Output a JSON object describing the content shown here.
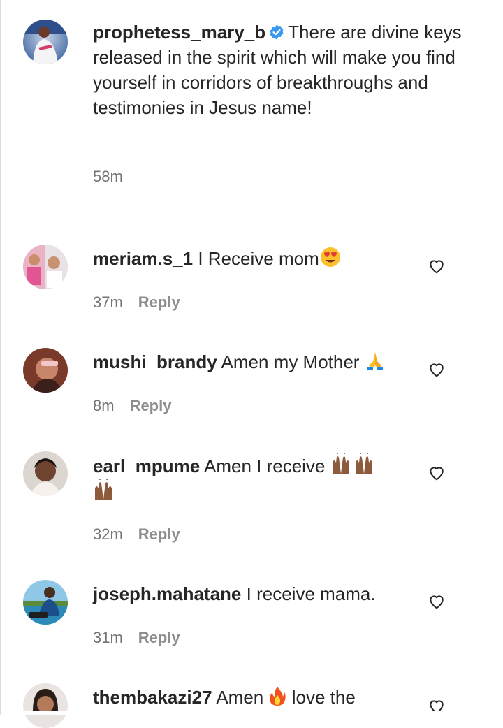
{
  "post": {
    "username": "prophetess_mary_b",
    "caption": "There are divine keys released in the spirit which will make you find yourself in corridors of breakthroughs and testimonies in Jesus name!",
    "time": "58m",
    "avatar_icon": "avatar-photo",
    "verified_icon": "verified-badge-icon",
    "verified_color": "#3897f0"
  },
  "comments": [
    {
      "username": "meriam.s_1",
      "text": "I Receive mom",
      "emoji": "heart-eyes-emoji",
      "time": "37m",
      "reply": "Reply"
    },
    {
      "username": "mushi_brandy",
      "text": "Amen my Mother",
      "emoji": "folded-hands-emoji",
      "time": "8m",
      "reply": "Reply"
    },
    {
      "username": "earl_mpume",
      "text": "Amen I receive",
      "emoji": "raising-hands-emoji",
      "time": "32m",
      "reply": "Reply"
    },
    {
      "username": "joseph.mahatane",
      "text": "I receive mama.",
      "time": "31m",
      "reply": "Reply"
    },
    {
      "username": "thembakazi27",
      "text": "Amen",
      "emoji": "fire-emoji",
      "text_after": "love the"
    }
  ],
  "colors": {
    "text": "#262626",
    "secondary": "#737373",
    "reply": "#8e8e8e",
    "divider": "#dbdbdb"
  }
}
